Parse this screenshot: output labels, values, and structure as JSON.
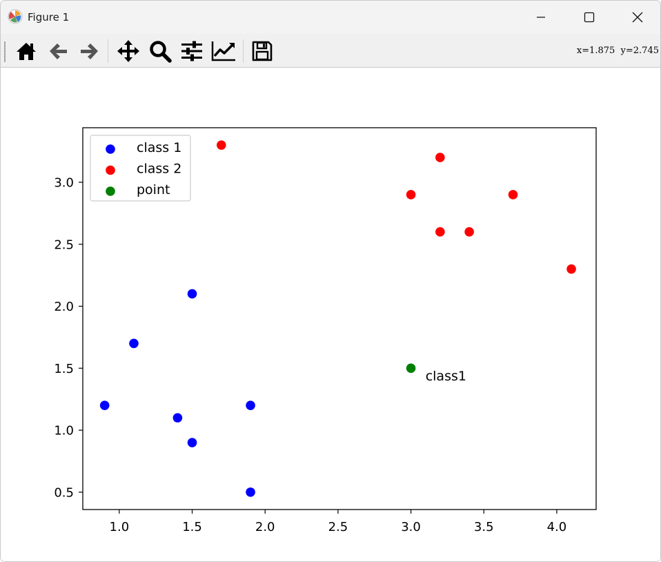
{
  "window": {
    "title": "Figure 1"
  },
  "toolbar": {
    "buttons": [
      {
        "name": "home-button",
        "icon": "home-icon"
      },
      {
        "name": "back-button",
        "icon": "arrow-left-icon"
      },
      {
        "name": "forward-button",
        "icon": "arrow-right-icon"
      },
      {
        "name": "pan-button",
        "icon": "move-icon"
      },
      {
        "name": "zoom-button",
        "icon": "magnifier-icon"
      },
      {
        "name": "configure-subplots-button",
        "icon": "sliders-icon"
      },
      {
        "name": "edit-axis-button",
        "icon": "line-chart-icon"
      },
      {
        "name": "save-button",
        "icon": "floppy-disk-icon"
      }
    ],
    "coords": "x=1.875  y=2.745"
  },
  "chart_data": {
    "type": "scatter",
    "title": "",
    "xlabel": "",
    "ylabel": "",
    "xlim": [
      0.75,
      4.27
    ],
    "ylim": [
      0.36,
      3.44
    ],
    "xticks": [
      1.0,
      1.5,
      2.0,
      2.5,
      3.0,
      3.5,
      4.0
    ],
    "xtick_labels": [
      "1.0",
      "1.5",
      "2.0",
      "2.5",
      "3.0",
      "3.5",
      "4.0"
    ],
    "yticks": [
      0.5,
      1.0,
      1.5,
      2.0,
      2.5,
      3.0
    ],
    "ytick_labels": [
      "0.5",
      "1.0",
      "1.5",
      "2.0",
      "2.5",
      "3.0"
    ],
    "grid": false,
    "legend_position": "top-left",
    "series": [
      {
        "name": "class 1",
        "color": "#0000ff",
        "x": [
          0.9,
          1.1,
          1.5,
          1.4,
          1.5,
          1.9,
          1.9
        ],
        "y": [
          1.2,
          1.7,
          2.1,
          1.1,
          0.9,
          1.2,
          0.5
        ]
      },
      {
        "name": "class 2",
        "color": "#ff0000",
        "x": [
          1.7,
          3.0,
          3.2,
          3.2,
          3.4,
          3.7,
          4.1
        ],
        "y": [
          3.3,
          2.9,
          3.2,
          2.6,
          2.6,
          2.9,
          2.3
        ]
      },
      {
        "name": "point",
        "color": "#008000",
        "x": [
          3.0
        ],
        "y": [
          1.5
        ]
      }
    ],
    "annotations": [
      {
        "text": "class1",
        "x": 3.1,
        "y": 1.44
      }
    ]
  }
}
